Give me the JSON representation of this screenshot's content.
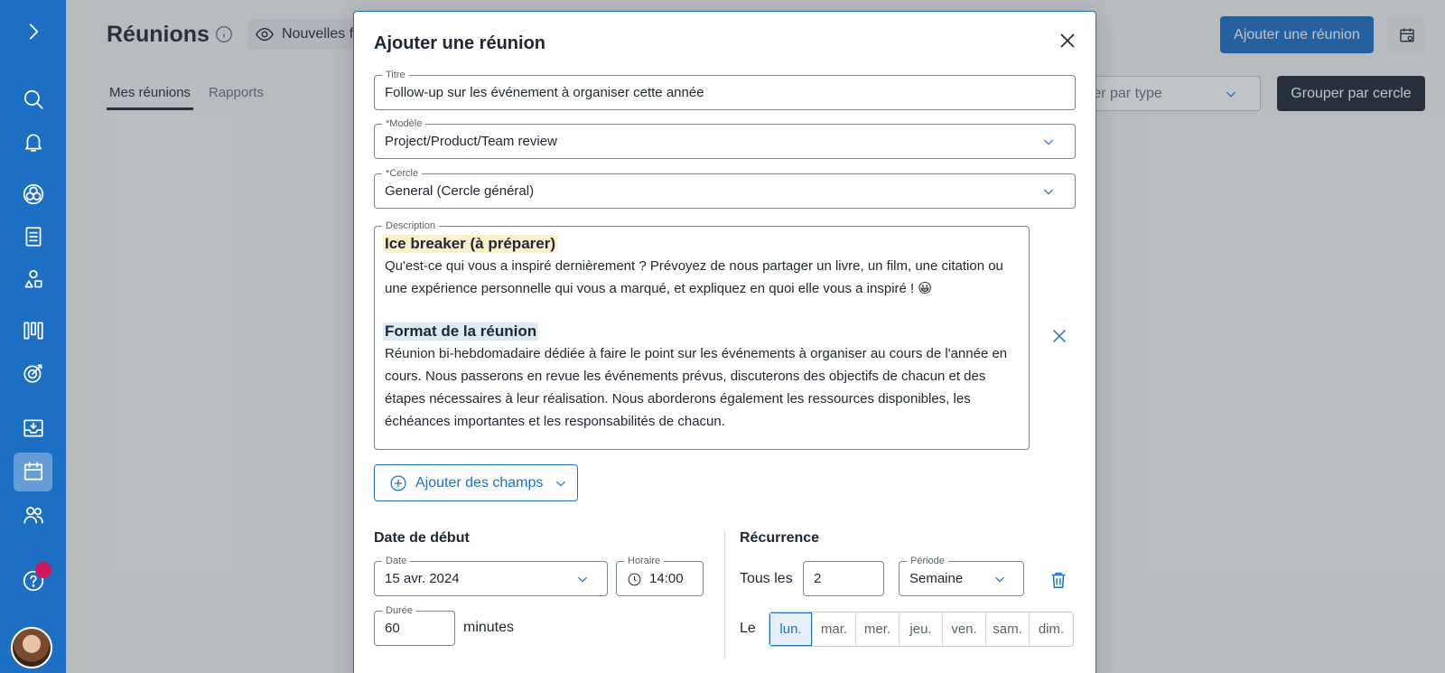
{
  "page": {
    "title": "Réunions",
    "chip_label": "Nouvelles fo",
    "tabs": [
      {
        "label": "Mes réunions",
        "active": true
      },
      {
        "label": "Rapports",
        "active": false
      }
    ],
    "add_meeting_label": "Ajouter une réunion",
    "filter_type_label": "rer par type",
    "group_by_label": "Grouper par cercle"
  },
  "sidebar": {
    "items": [
      "expand-icon",
      "search-icon",
      "bell-icon",
      "circles-icon",
      "document-icon",
      "roles-icon",
      "kanban-icon",
      "target-icon",
      "inbox-icon",
      "calendar-icon",
      "users-icon",
      "help-icon"
    ],
    "active": "calendar-icon"
  },
  "modal": {
    "title": "Ajouter une réunion",
    "titre": {
      "label": "Titre",
      "value": "Follow-up sur les événement à organiser cette année"
    },
    "modele": {
      "label": "*Modèle",
      "value": "Project/Product/Team review"
    },
    "cercle": {
      "label": "*Cercle",
      "value": "General (Cercle général)"
    },
    "description": {
      "label": "Description",
      "heading1": "Ice breaker (à préparer)",
      "para1": "Qu'est-ce qui vous a inspiré dernièrement ? Prévoyez de nous partager un livre, un film, une citation ou une expérience personnelle qui vous a marqué, et expliquez en quoi elle vous a inspiré ! 😀",
      "heading2": "Format de la réunion",
      "para2": "Réunion bi-hebdomadaire dédiée à faire le point sur les événements à organiser au cours de l'année en cours. Nous passerons en revue les événements prévus, discuterons des objectifs de chacun et des étapes nécessaires à leur réalisation. Nous aborderons également les ressources disponibles, les échéances importantes et les responsabilités de chacun."
    },
    "add_fields_label": "Ajouter des champs",
    "start": {
      "heading": "Date de début",
      "date_label": "Date",
      "date_value": "15 avr. 2024",
      "time_label": "Horaire",
      "time_value": "14:00",
      "duration_label": "Durée",
      "duration_value": "60",
      "duration_unit": "minutes"
    },
    "recurrence": {
      "heading": "Récurrence",
      "every_label": "Tous les",
      "every_value": "2",
      "period_label": "Période",
      "period_value": "Semaine",
      "on_label": "Le",
      "days": [
        "lun.",
        "mar.",
        "mer.",
        "jeu.",
        "ven.",
        "sam.",
        "dim."
      ],
      "active_day": "lun."
    }
  },
  "colors": {
    "brand": "#1d6fc4",
    "dark": "#1e2733",
    "notification": "#d1175a"
  }
}
